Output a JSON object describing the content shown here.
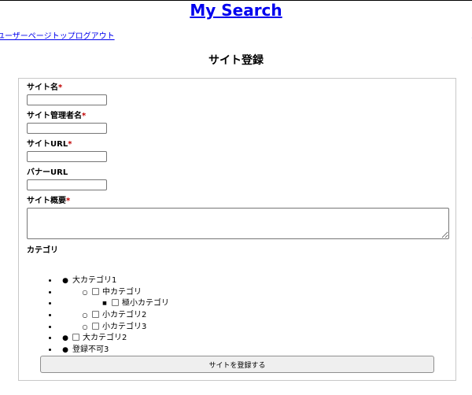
{
  "header": {
    "title": "My Search"
  },
  "nav": {
    "links": [
      "ユーザーページトップ",
      "ログアウト"
    ]
  },
  "page": {
    "title": "サイト登録"
  },
  "form": {
    "fields": [
      {
        "label": "サイト名",
        "required": true,
        "type": "text",
        "value": ""
      },
      {
        "label": "サイト管理者名",
        "required": true,
        "type": "text",
        "value": ""
      },
      {
        "label": "サイトURL",
        "required": true,
        "type": "text",
        "value": ""
      },
      {
        "label": "バナーURL",
        "required": false,
        "type": "text",
        "value": ""
      },
      {
        "label": "サイト概要",
        "required": true,
        "type": "textarea",
        "value": ""
      }
    ],
    "required_mark": "*",
    "category_label": "カテゴリ",
    "categories": [
      {
        "label": "大カテゴリ1",
        "checkbox": false,
        "level": 0
      },
      {
        "label": "中カテゴリ",
        "checkbox": true,
        "checked": false,
        "level": 1
      },
      {
        "label": "極小カテゴリ",
        "checkbox": true,
        "checked": false,
        "level": 2
      },
      {
        "label": "小カテゴリ2",
        "checkbox": true,
        "checked": false,
        "level": 1
      },
      {
        "label": "小カテゴリ3",
        "checkbox": true,
        "checked": false,
        "level": 1
      },
      {
        "label": "大カテゴリ2",
        "checkbox": true,
        "checked": false,
        "level": 0
      },
      {
        "label": "登録不可3",
        "checkbox": false,
        "level": 0
      }
    ],
    "submit_label": "サイトを登録する"
  },
  "colors": {
    "link": "#0000ee",
    "required": "#c00000",
    "border": "#c8c8c8"
  }
}
